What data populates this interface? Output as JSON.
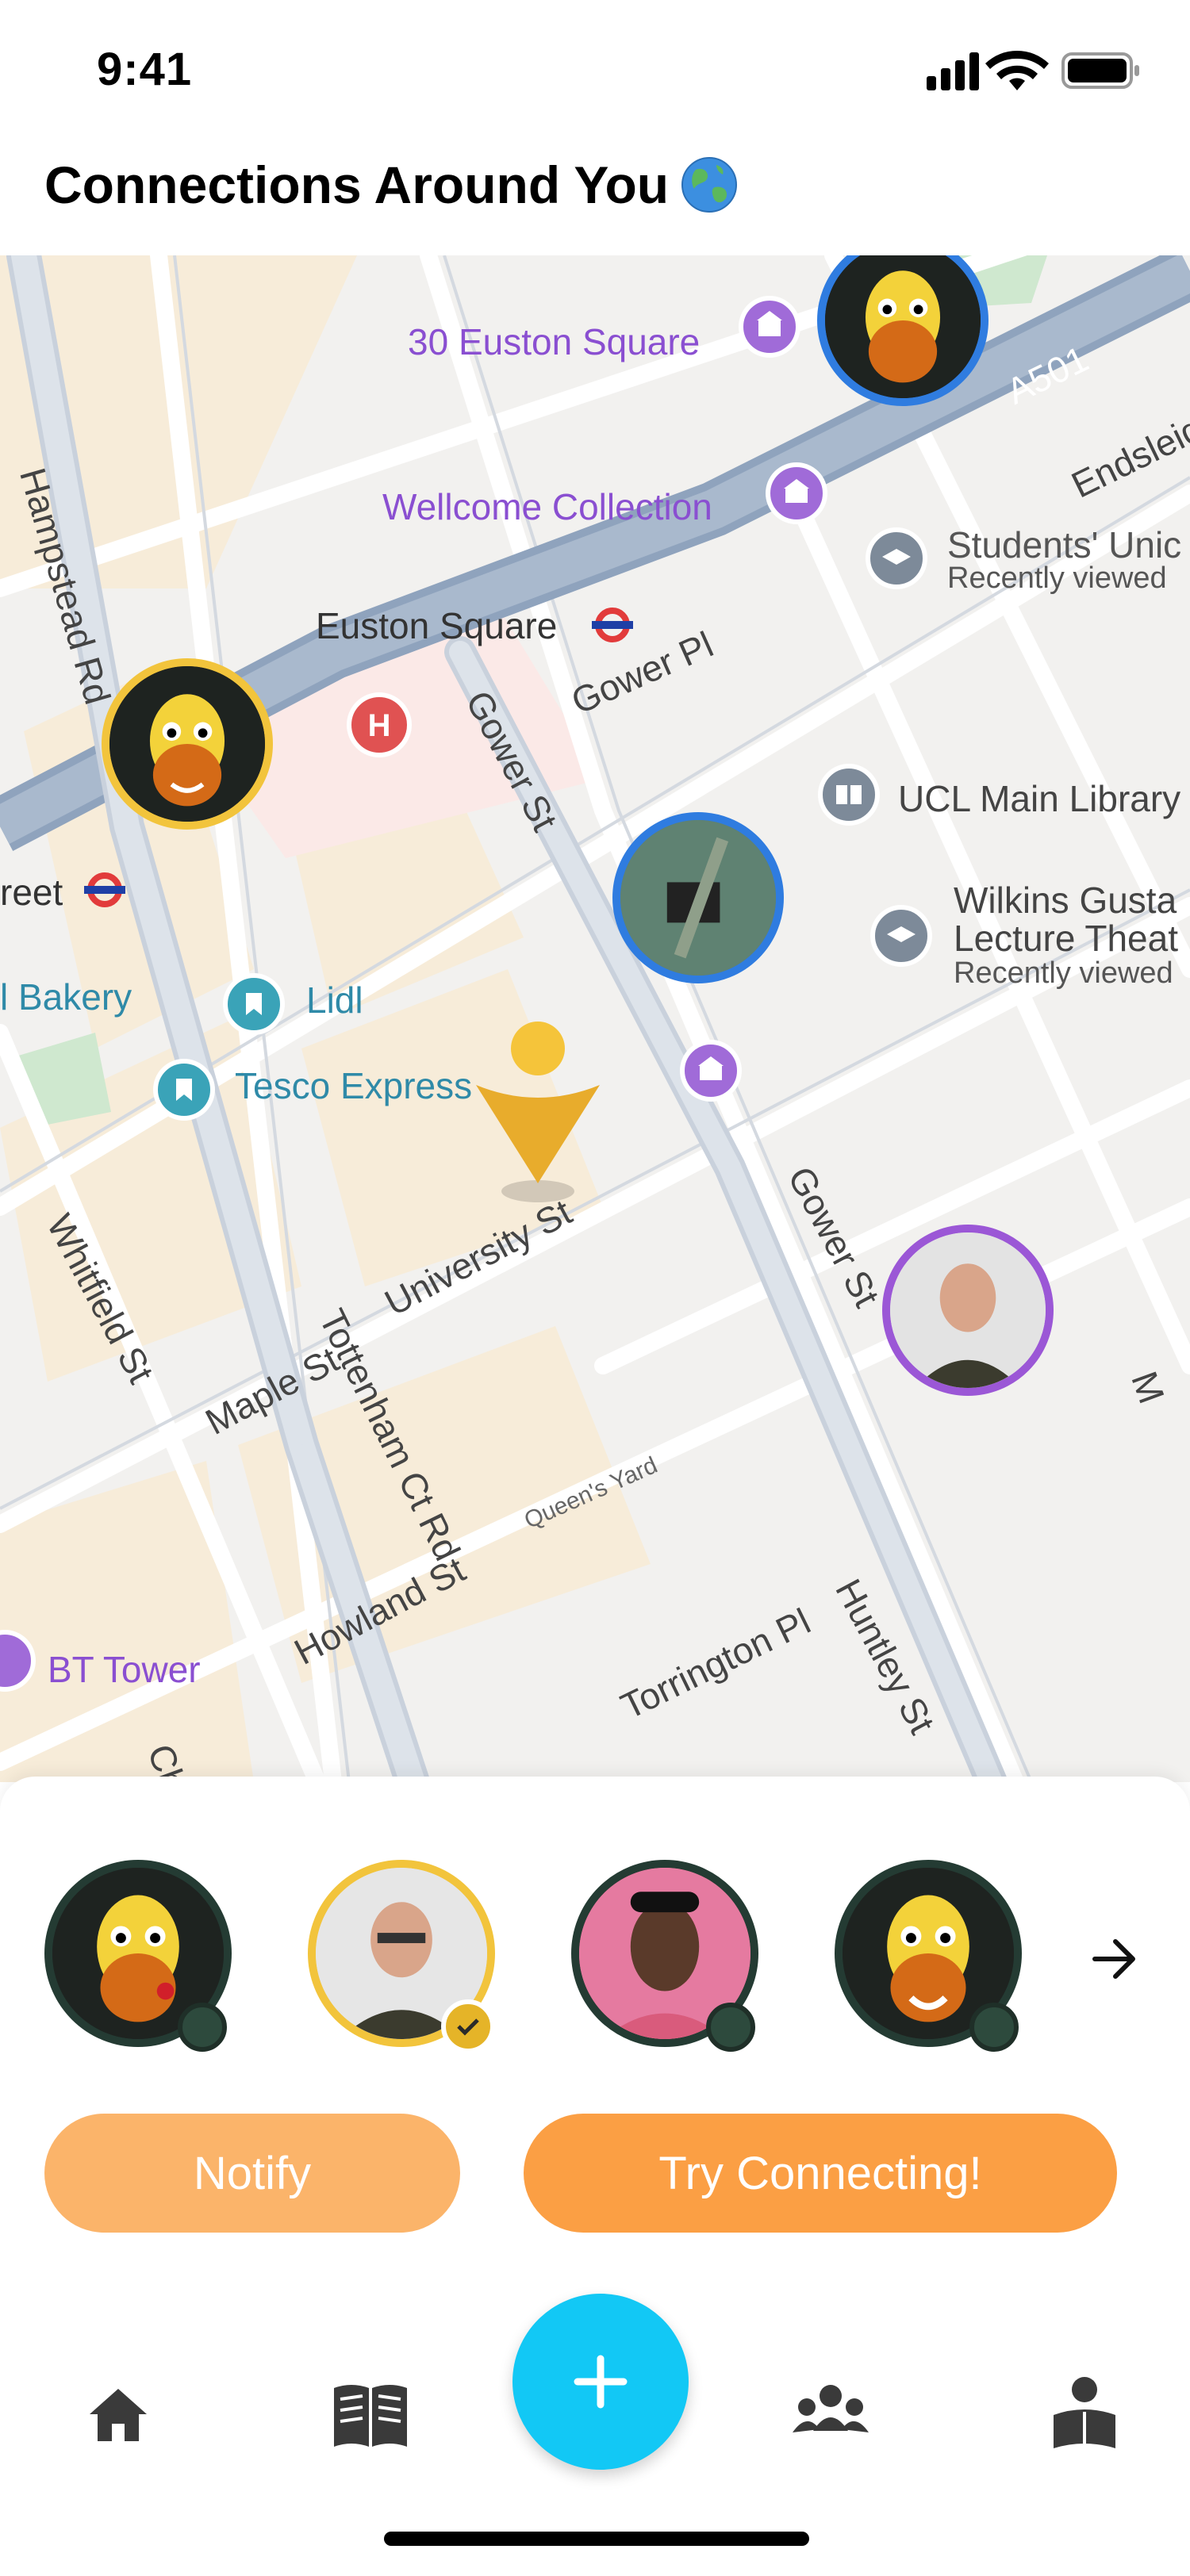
{
  "status_bar": {
    "time": "9:41"
  },
  "header": {
    "title": "Connections Around You",
    "emoji_icon": "globe-icon"
  },
  "map": {
    "labels": {
      "euston_square_30": "30 Euston Square",
      "wellcome": "Wellcome Collection",
      "students_union": "Students' Unic",
      "students_union_sub": "Recently viewed",
      "euston_square": "Euston Square",
      "gower_pl": "Gower Pl",
      "gower_st_1": "Gower St",
      "gower_st_2": "Gower St",
      "ucl_library": "UCL Main Library",
      "wilkins_1": "Wilkins Gusta",
      "wilkins_2": "Lecture Theat",
      "wilkins_sub": "Recently viewed",
      "street_frag": "reet",
      "bakery": "l Bakery",
      "lidl": "Lidl",
      "tesco": "Tesco Express",
      "university_st": "University St",
      "whitfield_st": "Whitfield St",
      "maple_st": "Maple St",
      "tottenham_ct_rd": "Tottenham Ct Rd",
      "queens_yard": "Queen's Yard",
      "howland_st": "Howland St",
      "torrington_pl": "Torrington Pl",
      "huntley_st": "Huntley St",
      "bt_tower": "BT Tower",
      "hampstead_rd": "Hampstead Rd",
      "a501": "A501",
      "endsleigh": "Endsleigh",
      "ch_frag": "Ch",
      "m_frag": "M"
    }
  },
  "connections": {
    "avatars": [
      {
        "name": "giraffe-avatar-1",
        "status": "offline"
      },
      {
        "name": "person-avatar-older-man",
        "status": "selected"
      },
      {
        "name": "person-avatar-young-man",
        "status": "offline"
      },
      {
        "name": "giraffe-avatar-2",
        "status": "offline"
      }
    ]
  },
  "actions": {
    "notify": "Notify",
    "connect": "Try Connecting!"
  },
  "nav": {
    "items": [
      "home-icon",
      "book-icon",
      "add-icon",
      "group-icon",
      "reader-icon"
    ]
  },
  "colors": {
    "notify": "#fbb46a",
    "connect": "#fb9f44",
    "fab": "#12c8f5",
    "poi_purple": "#a06bd8",
    "poi_teal": "#3aa3b8",
    "road_main": "#9fb3cc",
    "selected_ring": "#f2c43c"
  }
}
